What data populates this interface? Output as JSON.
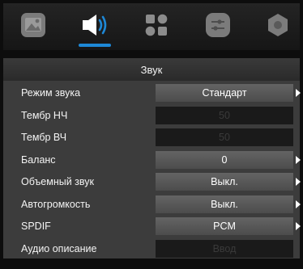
{
  "header": {
    "tabs": [
      {
        "icon": "picture-icon"
      },
      {
        "icon": "sound-icon",
        "active": true
      },
      {
        "icon": "apps-icon"
      },
      {
        "icon": "settings-icon"
      },
      {
        "icon": "lock-icon"
      }
    ],
    "accent_color": "#1e88d6"
  },
  "title": "Звук",
  "menu": {
    "items": [
      {
        "label": "Режим звука",
        "value": "Стандарт",
        "enabled": true,
        "has_arrow": true
      },
      {
        "label": "Тембр НЧ",
        "value": "50",
        "enabled": false,
        "has_arrow": false
      },
      {
        "label": "Тембр ВЧ",
        "value": "50",
        "enabled": false,
        "has_arrow": false
      },
      {
        "label": "Баланс",
        "value": "0",
        "enabled": true,
        "has_arrow": true
      },
      {
        "label": "Объемный звук",
        "value": "Выкл.",
        "enabled": true,
        "has_arrow": true
      },
      {
        "label": "Автогромкость",
        "value": "Выкл.",
        "enabled": true,
        "has_arrow": true
      },
      {
        "label": "SPDIF",
        "value": "PCM",
        "enabled": true,
        "has_arrow": true
      },
      {
        "label": "Аудио описание",
        "value": "Ввод",
        "enabled": false,
        "has_arrow": false
      }
    ]
  }
}
